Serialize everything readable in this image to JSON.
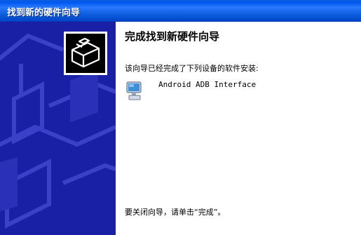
{
  "window": {
    "title": "找到新的硬件向导"
  },
  "wizard": {
    "heading": "完成找到新硬件向导",
    "subtitle": "该向导已经完成了下列设备的软件安装:",
    "device_name": "Android ADB Interface",
    "finish_hint": "要关闭向导，请单击“完成”。"
  },
  "icons": {
    "wizard": "hardware-wizard-icon",
    "device": "computer-monitor-icon"
  },
  "colors": {
    "titlebar": "#0058ee",
    "side_panel": "#1a20a6",
    "content_bg": "#ffffff"
  }
}
